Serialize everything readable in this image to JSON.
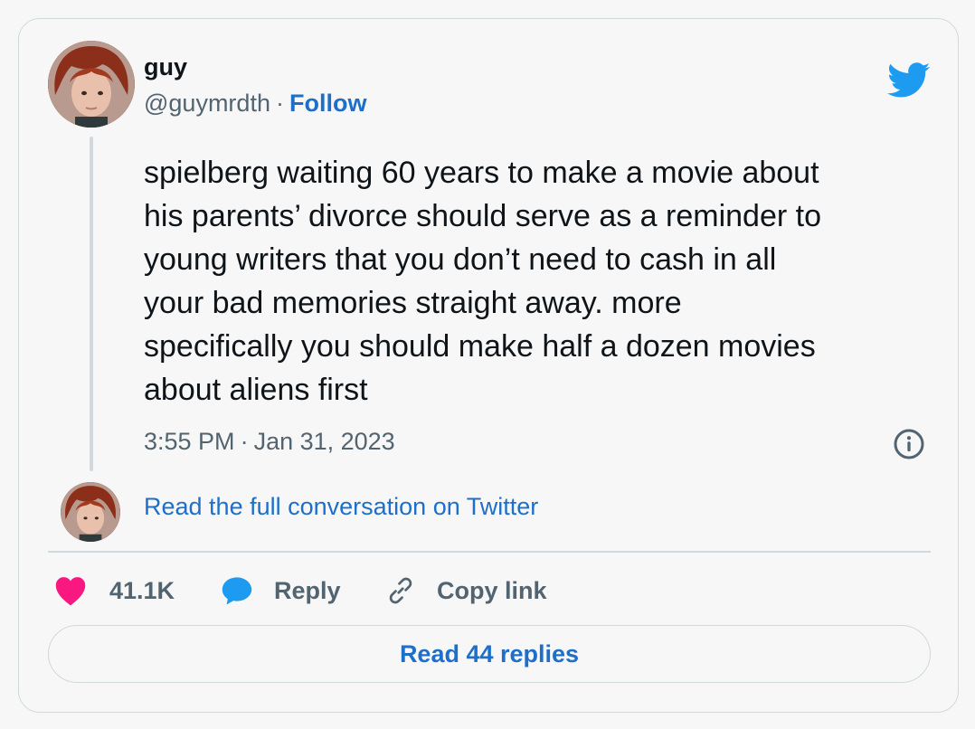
{
  "author": {
    "name": "guy",
    "handle": "@guymrdth",
    "separator": "·",
    "follow_label": "Follow"
  },
  "tweet": {
    "text": "spielberg waiting 60 years to make a movie about\nhis parents’ divorce should serve as a reminder to\nyoung writers that you don’t need to cash in all\nyour bad memories straight away. more\nspecifically you should make half a dozen movies\nabout aliens first",
    "time": "3:55 PM",
    "separator": "·",
    "date": "Jan 31, 2023"
  },
  "conversation": {
    "link_label": "Read the full conversation on Twitter"
  },
  "actions": {
    "like_count": "41.1K",
    "reply_label": "Reply",
    "copy_link_label": "Copy link"
  },
  "replies": {
    "button_label": "Read 44 replies"
  },
  "icons": {
    "brand": "twitter-bird-icon",
    "info": "info-icon",
    "like": "heart-icon",
    "reply": "speech-bubble-icon",
    "copy": "link-icon"
  },
  "colors": {
    "link": "#1d6fc9",
    "twitter": "#1d9bf0",
    "like": "#f91880",
    "secondary_text": "#536471",
    "border": "#cfd9de"
  }
}
